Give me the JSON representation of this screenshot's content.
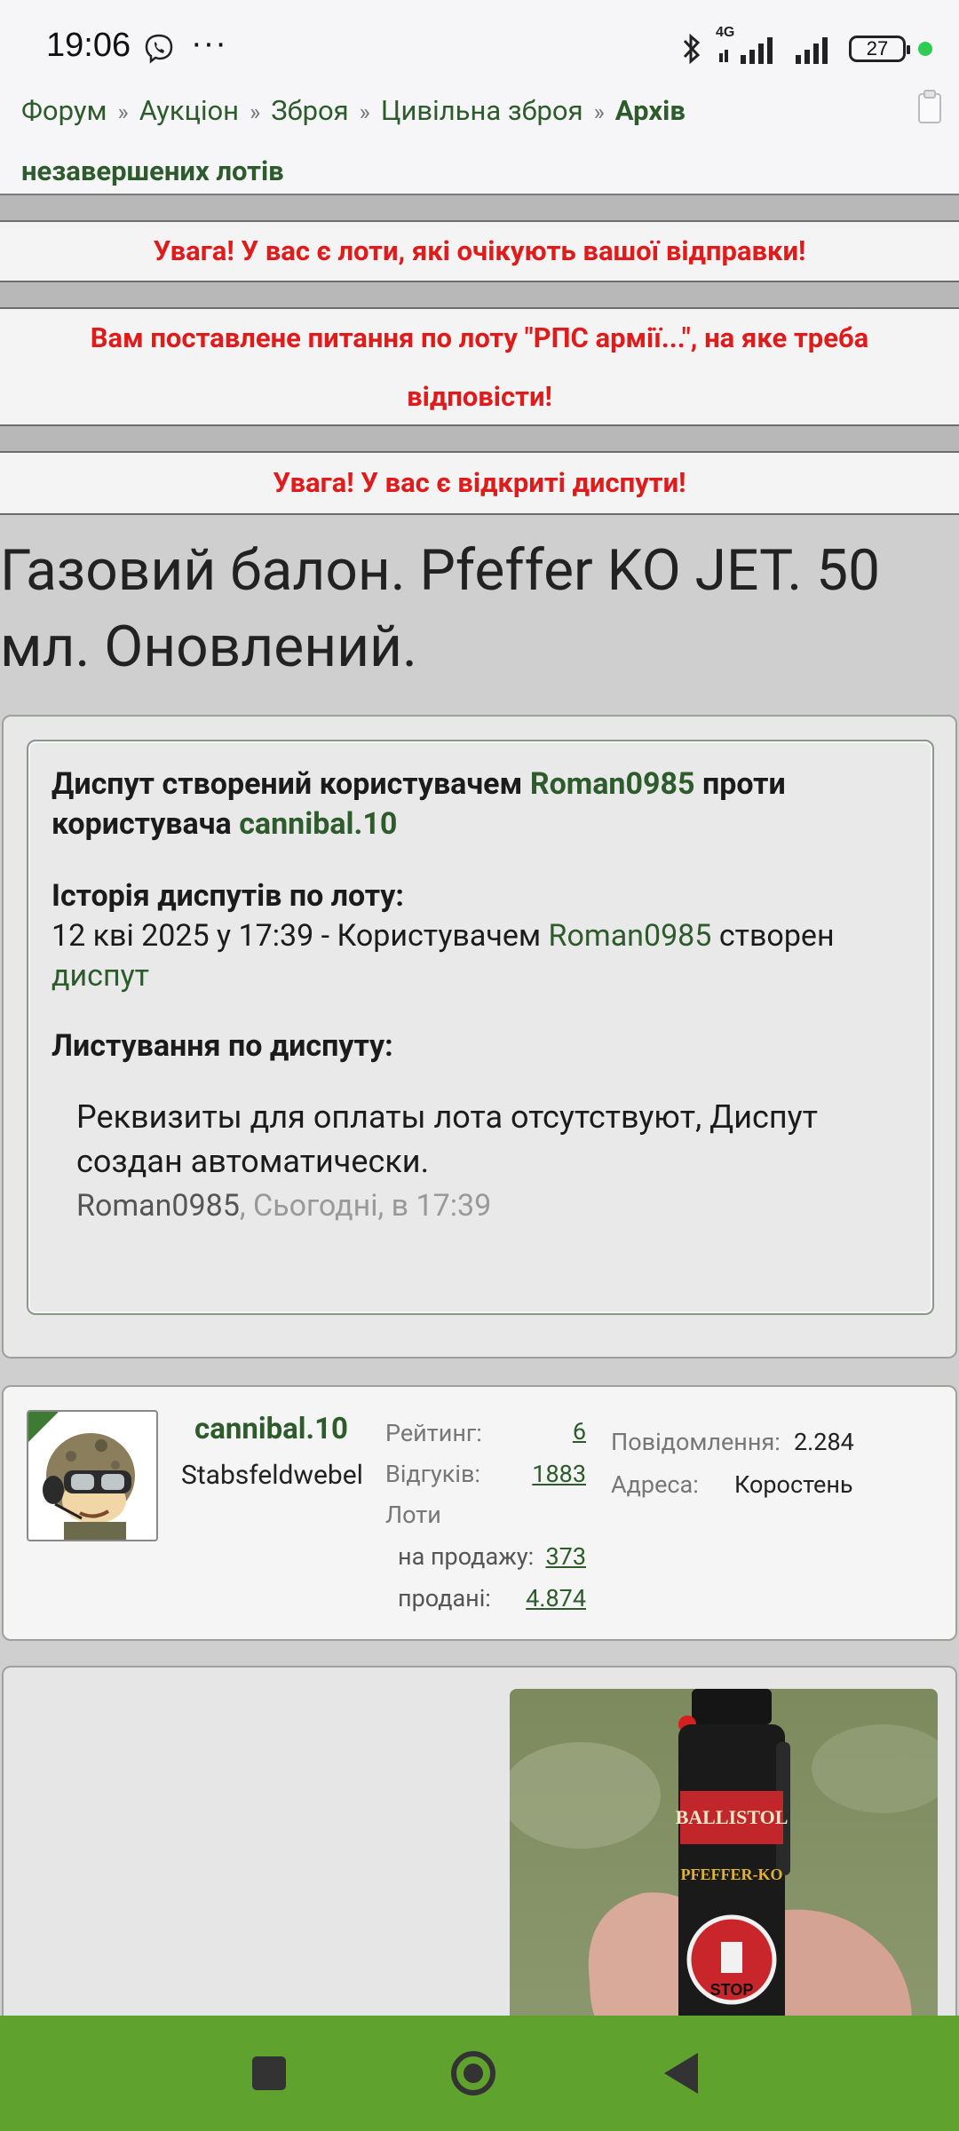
{
  "status_bar": {
    "time": "19:06",
    "more": "···",
    "network": "4G",
    "battery": "27",
    "icons": [
      "viber-icon",
      "bluetooth-icon",
      "signal-icon",
      "battery-icon"
    ]
  },
  "breadcrumbs": {
    "items": [
      "Форум",
      "Аукціон",
      "Зброя",
      "Цивільна зброя"
    ],
    "current": "Архів незавершених лотів",
    "separator": "»"
  },
  "notices": [
    {
      "text": "Увага! У вас є лоти, які очікують вашої відправки!"
    },
    {
      "text": "Вам поставлене питання по лоту \"РПС армії...\", на яке треба відповісти!"
    },
    {
      "text": "Увага! У вас є відкриті диспути!"
    }
  ],
  "lot": {
    "title": "Газовий балон. Pfeffer KO JET. 50 мл. Оновлений."
  },
  "dispute": {
    "created_prefix": "Диспут створений користувачем",
    "creator": "Roman0985",
    "against_label": "проти користувача",
    "against_user": "cannibal.10",
    "history_heading": "Історія диспутів по лоту:",
    "history_entry_prefix": "12 кві 2025 у 17:39 - Користувачем",
    "history_entry_user": "Roman0985",
    "history_entry_action": "створен",
    "history_entry_link": "диспут",
    "correspondence_heading": "Листування по диспуту:",
    "message_text": "Реквизиты для оплаты лота отсутствуют, Диспут создан автоматически.",
    "message_author": "Roman0985",
    "message_time": ", Сьогодні, в 17:39"
  },
  "seller": {
    "name": "cannibal.10",
    "rank": "Stabsfeldwebel",
    "rating_label": "Рейтинг:",
    "rating": "6",
    "reviews_label": "Відгуків:",
    "reviews": "1883",
    "lots_label": "Лоти",
    "for_sale_label": "на продажу:",
    "for_sale": "373",
    "sold_label": "продані:",
    "sold": "4.874",
    "messages_label": "Повідомлення:",
    "messages": "2.284",
    "address_label": "Адреса:",
    "address": "Коростень"
  },
  "photo": {
    "brand_text": "BALLISTOL",
    "product_text": "PFEFFER-KO",
    "stop_text": "STOP"
  },
  "colors": {
    "link_green": "#2d5b2b",
    "alert_red": "#e01b1b",
    "navbar_green": "#5fa32e"
  }
}
